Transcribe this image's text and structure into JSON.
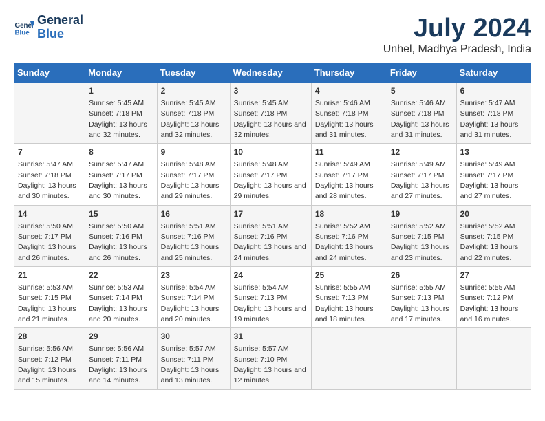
{
  "logo": {
    "line1": "General",
    "line2": "Blue"
  },
  "title": "July 2024",
  "subtitle": "Unhel, Madhya Pradesh, India",
  "headers": [
    "Sunday",
    "Monday",
    "Tuesday",
    "Wednesday",
    "Thursday",
    "Friday",
    "Saturday"
  ],
  "weeks": [
    [
      {
        "day": "",
        "sunrise": "",
        "sunset": "",
        "daylight": ""
      },
      {
        "day": "1",
        "sunrise": "Sunrise: 5:45 AM",
        "sunset": "Sunset: 7:18 PM",
        "daylight": "Daylight: 13 hours and 32 minutes."
      },
      {
        "day": "2",
        "sunrise": "Sunrise: 5:45 AM",
        "sunset": "Sunset: 7:18 PM",
        "daylight": "Daylight: 13 hours and 32 minutes."
      },
      {
        "day": "3",
        "sunrise": "Sunrise: 5:45 AM",
        "sunset": "Sunset: 7:18 PM",
        "daylight": "Daylight: 13 hours and 32 minutes."
      },
      {
        "day": "4",
        "sunrise": "Sunrise: 5:46 AM",
        "sunset": "Sunset: 7:18 PM",
        "daylight": "Daylight: 13 hours and 31 minutes."
      },
      {
        "day": "5",
        "sunrise": "Sunrise: 5:46 AM",
        "sunset": "Sunset: 7:18 PM",
        "daylight": "Daylight: 13 hours and 31 minutes."
      },
      {
        "day": "6",
        "sunrise": "Sunrise: 5:47 AM",
        "sunset": "Sunset: 7:18 PM",
        "daylight": "Daylight: 13 hours and 31 minutes."
      }
    ],
    [
      {
        "day": "7",
        "sunrise": "Sunrise: 5:47 AM",
        "sunset": "Sunset: 7:18 PM",
        "daylight": "Daylight: 13 hours and 30 minutes."
      },
      {
        "day": "8",
        "sunrise": "Sunrise: 5:47 AM",
        "sunset": "Sunset: 7:17 PM",
        "daylight": "Daylight: 13 hours and 30 minutes."
      },
      {
        "day": "9",
        "sunrise": "Sunrise: 5:48 AM",
        "sunset": "Sunset: 7:17 PM",
        "daylight": "Daylight: 13 hours and 29 minutes."
      },
      {
        "day": "10",
        "sunrise": "Sunrise: 5:48 AM",
        "sunset": "Sunset: 7:17 PM",
        "daylight": "Daylight: 13 hours and 29 minutes."
      },
      {
        "day": "11",
        "sunrise": "Sunrise: 5:49 AM",
        "sunset": "Sunset: 7:17 PM",
        "daylight": "Daylight: 13 hours and 28 minutes."
      },
      {
        "day": "12",
        "sunrise": "Sunrise: 5:49 AM",
        "sunset": "Sunset: 7:17 PM",
        "daylight": "Daylight: 13 hours and 27 minutes."
      },
      {
        "day": "13",
        "sunrise": "Sunrise: 5:49 AM",
        "sunset": "Sunset: 7:17 PM",
        "daylight": "Daylight: 13 hours and 27 minutes."
      }
    ],
    [
      {
        "day": "14",
        "sunrise": "Sunrise: 5:50 AM",
        "sunset": "Sunset: 7:17 PM",
        "daylight": "Daylight: 13 hours and 26 minutes."
      },
      {
        "day": "15",
        "sunrise": "Sunrise: 5:50 AM",
        "sunset": "Sunset: 7:16 PM",
        "daylight": "Daylight: 13 hours and 26 minutes."
      },
      {
        "day": "16",
        "sunrise": "Sunrise: 5:51 AM",
        "sunset": "Sunset: 7:16 PM",
        "daylight": "Daylight: 13 hours and 25 minutes."
      },
      {
        "day": "17",
        "sunrise": "Sunrise: 5:51 AM",
        "sunset": "Sunset: 7:16 PM",
        "daylight": "Daylight: 13 hours and 24 minutes."
      },
      {
        "day": "18",
        "sunrise": "Sunrise: 5:52 AM",
        "sunset": "Sunset: 7:16 PM",
        "daylight": "Daylight: 13 hours and 24 minutes."
      },
      {
        "day": "19",
        "sunrise": "Sunrise: 5:52 AM",
        "sunset": "Sunset: 7:15 PM",
        "daylight": "Daylight: 13 hours and 23 minutes."
      },
      {
        "day": "20",
        "sunrise": "Sunrise: 5:52 AM",
        "sunset": "Sunset: 7:15 PM",
        "daylight": "Daylight: 13 hours and 22 minutes."
      }
    ],
    [
      {
        "day": "21",
        "sunrise": "Sunrise: 5:53 AM",
        "sunset": "Sunset: 7:15 PM",
        "daylight": "Daylight: 13 hours and 21 minutes."
      },
      {
        "day": "22",
        "sunrise": "Sunrise: 5:53 AM",
        "sunset": "Sunset: 7:14 PM",
        "daylight": "Daylight: 13 hours and 20 minutes."
      },
      {
        "day": "23",
        "sunrise": "Sunrise: 5:54 AM",
        "sunset": "Sunset: 7:14 PM",
        "daylight": "Daylight: 13 hours and 20 minutes."
      },
      {
        "day": "24",
        "sunrise": "Sunrise: 5:54 AM",
        "sunset": "Sunset: 7:13 PM",
        "daylight": "Daylight: 13 hours and 19 minutes."
      },
      {
        "day": "25",
        "sunrise": "Sunrise: 5:55 AM",
        "sunset": "Sunset: 7:13 PM",
        "daylight": "Daylight: 13 hours and 18 minutes."
      },
      {
        "day": "26",
        "sunrise": "Sunrise: 5:55 AM",
        "sunset": "Sunset: 7:13 PM",
        "daylight": "Daylight: 13 hours and 17 minutes."
      },
      {
        "day": "27",
        "sunrise": "Sunrise: 5:55 AM",
        "sunset": "Sunset: 7:12 PM",
        "daylight": "Daylight: 13 hours and 16 minutes."
      }
    ],
    [
      {
        "day": "28",
        "sunrise": "Sunrise: 5:56 AM",
        "sunset": "Sunset: 7:12 PM",
        "daylight": "Daylight: 13 hours and 15 minutes."
      },
      {
        "day": "29",
        "sunrise": "Sunrise: 5:56 AM",
        "sunset": "Sunset: 7:11 PM",
        "daylight": "Daylight: 13 hours and 14 minutes."
      },
      {
        "day": "30",
        "sunrise": "Sunrise: 5:57 AM",
        "sunset": "Sunset: 7:11 PM",
        "daylight": "Daylight: 13 hours and 13 minutes."
      },
      {
        "day": "31",
        "sunrise": "Sunrise: 5:57 AM",
        "sunset": "Sunset: 7:10 PM",
        "daylight": "Daylight: 13 hours and 12 minutes."
      },
      {
        "day": "",
        "sunrise": "",
        "sunset": "",
        "daylight": ""
      },
      {
        "day": "",
        "sunrise": "",
        "sunset": "",
        "daylight": ""
      },
      {
        "day": "",
        "sunrise": "",
        "sunset": "",
        "daylight": ""
      }
    ]
  ]
}
